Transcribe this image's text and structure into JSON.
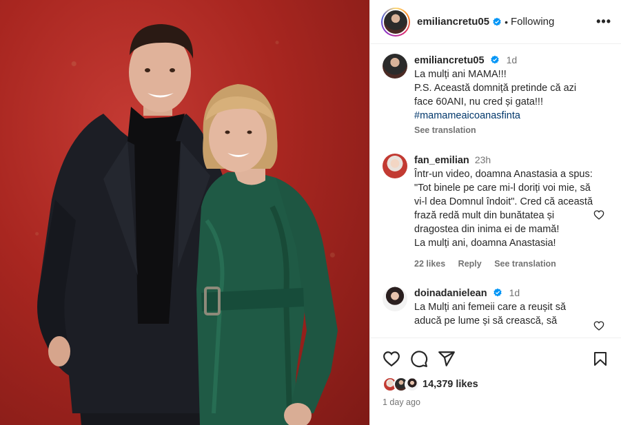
{
  "post": {
    "username": "emiliancretu05",
    "follow_status": "Following",
    "photo_alt": "Man in black suit and turtleneck standing with a woman in green satin dress in front of a red textured wall"
  },
  "caption": {
    "username": "emiliancretu05",
    "time": "1d",
    "lines": [
      "La mulți ani MAMA!!!",
      "P.S. Această domniță pretinde că azi face 60ANI, nu cred și gata!!!"
    ],
    "hashtag": "#mamameaicoanasfinta",
    "see_translation": "See translation"
  },
  "comments": [
    {
      "username": "fan_emilian",
      "time": "23h",
      "text_lines": [
        "Într-un video, doamna Anastasia a spus: \"Tot binele pe care mi-l doriți voi mie, să vi-l dea Domnul îndoit\". Cred că această frază redă mult din bunătatea și dragostea din inima ei de mamă!",
        "La mulți ani, doamna Anastasia!"
      ],
      "likes": "22 likes",
      "reply": "Reply",
      "see_translation": "See translation"
    },
    {
      "username": "doinadanielean",
      "time": "1d",
      "text": "La Mulți ani femeii care a reușit să aducă pe lume și să crească, să"
    }
  ],
  "footer": {
    "likes": "14,379 likes",
    "posted": "1 day ago"
  },
  "icons": {
    "header_more": "more-options-icon",
    "like": "heart-icon",
    "comment": "comment-icon",
    "share": "share-icon",
    "save": "bookmark-icon",
    "verified": "verified-badge-icon"
  },
  "colors": {
    "verified_blue": "#0095f6",
    "muted_text": "#737373",
    "hashtag": "#00376b",
    "photo_background": "#a82620",
    "dress": "#1f5a45",
    "suit": "#1a1c22"
  }
}
